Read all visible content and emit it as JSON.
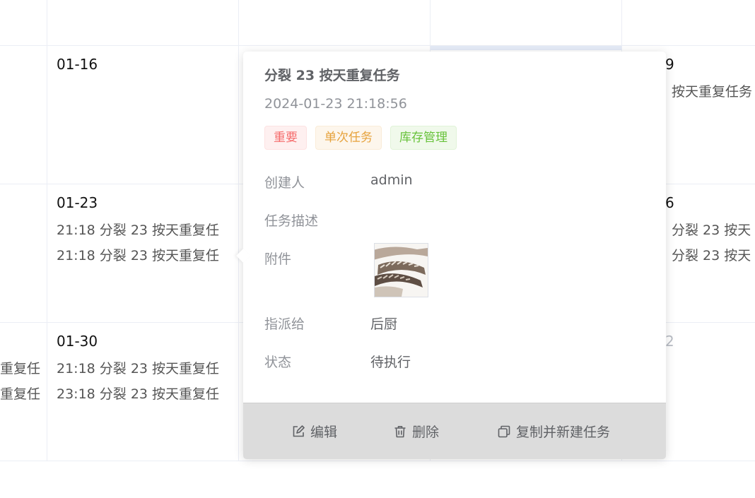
{
  "calendar": {
    "rows": [
      {
        "cells": [
          {
            "date": "01-16",
            "events": []
          },
          {
            "date": "9",
            "events": [
              "按天重复任务"
            ]
          }
        ]
      },
      {
        "cells": [
          {
            "date": "01-23",
            "events": [
              "21:18 分裂 23 按天重复任",
              "21:18 分裂 23 按天重复任"
            ]
          },
          {
            "date": "6",
            "events": [
              "分裂 23 按天",
              "分裂 23 按天"
            ]
          }
        ]
      },
      {
        "cells": [
          {
            "date": "",
            "events": [
              "重复任",
              "重复任"
            ]
          },
          {
            "date": "01-30",
            "events": [
              "21:18 分裂 23 按天重复任",
              "23:18 分裂 23 按天重复任"
            ]
          },
          {
            "date": "2",
            "events": []
          }
        ]
      }
    ]
  },
  "popover": {
    "title": "分裂 23 按天重复任务",
    "datetime": "2024-01-23 21:18:56",
    "tags": [
      {
        "label": "重要",
        "color": "#f56c6c"
      },
      {
        "label": "单次任务",
        "color": "#e6a23c"
      },
      {
        "label": "库存管理",
        "color": "#67c23a"
      }
    ],
    "fields": {
      "creator": {
        "label": "创建人",
        "value": "admin"
      },
      "description": {
        "label": "任务描述",
        "value": ""
      },
      "attachment": {
        "label": "附件",
        "thumbnail_icon": "shrimp-photo"
      },
      "assignee": {
        "label": "指派给",
        "value": "后厨"
      },
      "status": {
        "label": "状态",
        "value": "待执行"
      }
    },
    "actions": {
      "edit": {
        "label": "编辑",
        "icon": "edit-icon"
      },
      "delete": {
        "label": "删除",
        "icon": "trash-icon"
      },
      "copy": {
        "label": "复制并新建任务",
        "icon": "copy-icon"
      }
    }
  }
}
